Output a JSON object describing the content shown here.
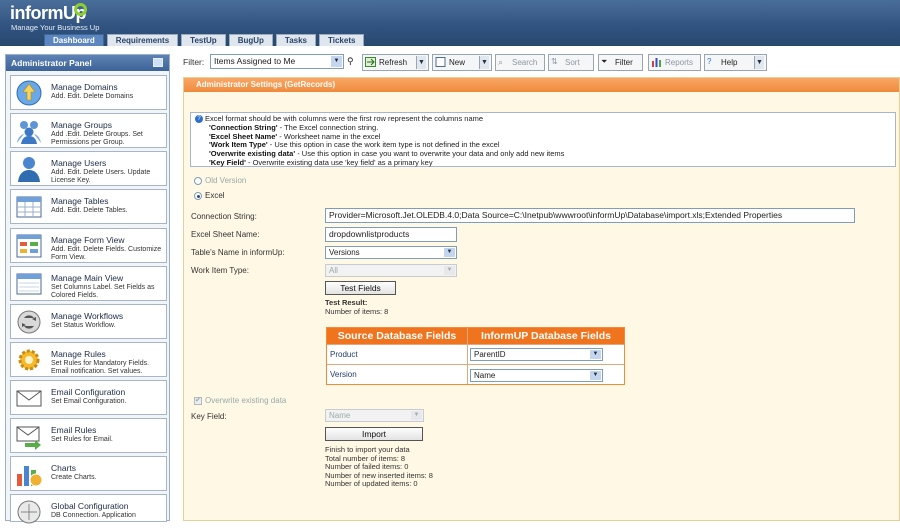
{
  "app": {
    "logo_text": "informUp",
    "tagline": "Manage Your Business Up"
  },
  "tabs": [
    "Dashboard",
    "Requirements",
    "TestUp",
    "BugUp",
    "Tasks",
    "Tickets"
  ],
  "sidebar": {
    "title": "Administrator Panel",
    "items": [
      {
        "title": "Manage Domains",
        "desc": "Add. Edit. Delete Domains",
        "icon": "globe-icon"
      },
      {
        "title": "Manage Groups",
        "desc": "Add .Edit. Delete Groups. Set Permissions per Group.",
        "icon": "group-icon"
      },
      {
        "title": "Manage Users",
        "desc": "Add. Edit. Delete Users. Update License Key.",
        "icon": "user-icon"
      },
      {
        "title": "Manage Tables",
        "desc": "Add. Edit. Delete Tables.",
        "icon": "table-icon"
      },
      {
        "title": "Manage Form View",
        "desc": "Add. Edit. Delete Fields. Customize Form View.",
        "icon": "form-icon"
      },
      {
        "title": "Manage Main View",
        "desc": "Set Columns Label. Set Fields as Colored Fields.",
        "icon": "main-view-icon"
      },
      {
        "title": "Manage Workflows",
        "desc": "Set Status Workflow.",
        "icon": "workflow-icon"
      },
      {
        "title": "Manage Rules",
        "desc": "Set Rules for Mandatory Fields. Email notification. Set values.",
        "icon": "gear-icon"
      },
      {
        "title": "Email Configuration",
        "desc": "Set Email Configuration.",
        "icon": "envelope-icon"
      },
      {
        "title": "Email Rules",
        "desc": "Set Rules for Email.",
        "icon": "email-rules-icon"
      },
      {
        "title": "Charts",
        "desc": "Create Charts.",
        "icon": "chart-icon"
      },
      {
        "title": "Global Configuration",
        "desc": "DB Connection. Application",
        "icon": "global-config-icon"
      }
    ]
  },
  "toolbar": {
    "filter_label": "Filter:",
    "filter_value": "Items Assigned to Me",
    "refresh": "Refresh",
    "new": "New",
    "search": "Search",
    "sort": "Sort",
    "filter": "Filter",
    "reports": "Reports",
    "help": "Help"
  },
  "settings": {
    "title": "Administrator Settings (GetRecords)",
    "info_intro": "Excel format should be with columns were the first row represent the columns name",
    "info_lines": [
      {
        "key": "'Connection String'",
        "text": " - The Excel connection string."
      },
      {
        "key": "'Excel Sheet Name'",
        "text": " - Worksheet name in the excel"
      },
      {
        "key": "'Work Item Type'",
        "text": " - Use this option in case the work item type is not defined in the excel"
      },
      {
        "key": "'Overwrite existing data'",
        "text": " - Use this option in case you want to overwrite your data and only add new items"
      },
      {
        "key": "'Key Field'",
        "text": " - Overwrite existing data use 'key field' as a primary key"
      }
    ],
    "old_version": "Old Version",
    "excel": "Excel",
    "connection_string_label": "Connection String:",
    "connection_string": "Provider=Microsoft.Jet.OLEDB.4.0;Data Source=C:\\Inetpub\\wwwroot\\informUp\\Database\\import.xls;Extended Properties",
    "sheet_name_label": "Excel Sheet Name:",
    "sheet_name": "dropdownlistproducts",
    "table_name_label": "Table's Name in informUp:",
    "table_name": "Versions",
    "work_item_type_label": "Work Item Type:",
    "work_item_type": "All",
    "test_fields_button": "Test Fields",
    "test_result_label": "Test Result:",
    "test_result": "Number of items: 8",
    "mapping": {
      "source_header": "Source Database Fields",
      "target_header": "InformUP Database Fields",
      "rows": [
        {
          "source": "Product",
          "target": "ParentID"
        },
        {
          "source": "Version",
          "target": "Name"
        }
      ]
    },
    "overwrite_label": "Overwrite existing data",
    "key_field_label": "Key Field:",
    "key_field": "Name",
    "import_button": "Import",
    "results": [
      "Finish to import your data",
      "Total number of items: 8",
      "Number of failed items: 0",
      "Number of new inserted items: 8",
      "Number of updated items: 0"
    ]
  },
  "colors": {
    "header_blue": "#2f527f",
    "accent_orange": "#f0741e",
    "panel_bg": "#fff8e5"
  }
}
